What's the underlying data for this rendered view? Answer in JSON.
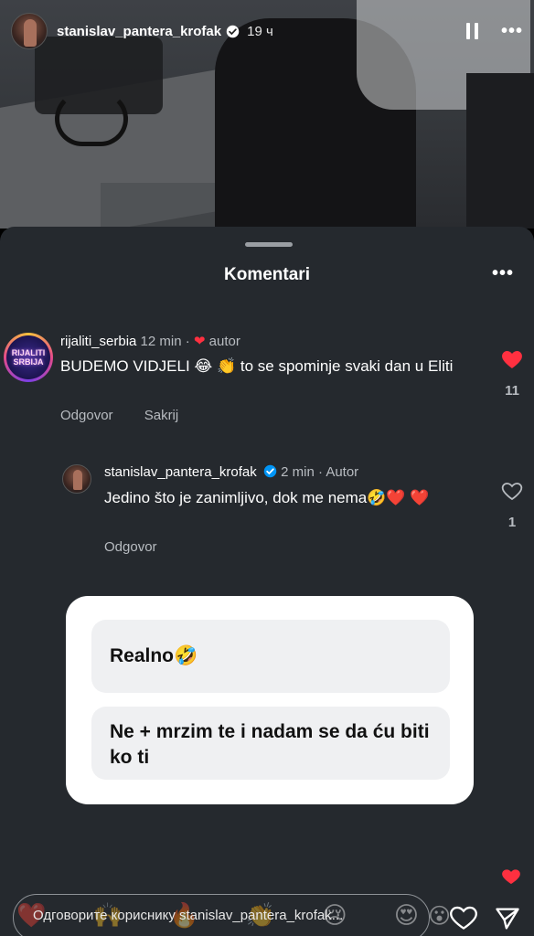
{
  "story": {
    "username": "stanislav_pantera_krofak",
    "time": "19 ч"
  },
  "sheet": {
    "title": "Komentari"
  },
  "comments": [
    {
      "username": "rijaliti_serbia",
      "avatar_text": "RIJALITI SRBIJA",
      "time": "12 min",
      "dot": "·",
      "author_label": "autor",
      "text": "BUDEMO VIDJELI 😂 👏 to se spominje svaki dan u Eliti",
      "actions": [
        "Odgovor",
        "Sakrij"
      ],
      "likes": "11",
      "liked": true
    },
    {
      "username": "stanislav_pantera_krofak",
      "time": "2 min",
      "dot": "·",
      "author_label": "Autor",
      "text": "Jedino što je zanimljivo, dok me nema🤣❤️ ❤️",
      "actions": [
        "Odgovor"
      ],
      "likes": "1",
      "liked": false
    }
  ],
  "card": {
    "options": [
      "Realno🤣",
      "Ne + mrzim te i nadam se da ću biti ko ti"
    ]
  },
  "reply": {
    "placeholder": "Одговорите кориснику stanislav_pantera_krofak..."
  },
  "emojis": [
    "❤️",
    "🙌",
    "🔥",
    "👏",
    "😢",
    "😍",
    "😮",
    "😂"
  ],
  "colors": {
    "sheet_bg": "#25292e",
    "like_red": "#ff3040",
    "verified_blue": "#0095f6"
  }
}
